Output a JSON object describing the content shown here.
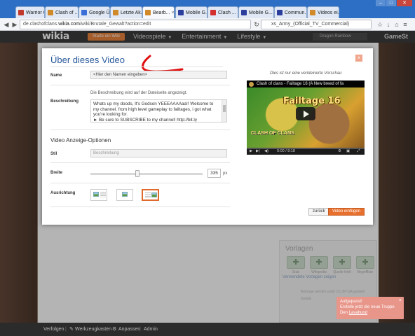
{
  "browser": {
    "tabs": [
      {
        "label": "Warrior C...",
        "color": "#c0392b"
      },
      {
        "label": "Clash of ...",
        "color": "#d08a2a"
      },
      {
        "label": "Google Ü...",
        "color": "#3b6fd8"
      },
      {
        "label": "Letzte Ak...",
        "color": "#d08a2a"
      },
      {
        "label": "Bearb...",
        "color": "#d08a2a"
      },
      {
        "label": "Mobile G...",
        "color": "#2c3e9c"
      },
      {
        "label": "Clash ...",
        "color": "#d32f2f"
      },
      {
        "label": "Mobile G...",
        "color": "#2c3e9c"
      },
      {
        "label": "Commun...",
        "color": "#2c3e9c"
      },
      {
        "label": "Videos ei...",
        "color": "#d08a2a"
      }
    ],
    "active_tab_index": 4,
    "url_prefix": "de.clashofclans.",
    "url_domain": "wikia.com",
    "url_rest": "/wiki/Brutale_Gewalt?action=edit",
    "search_value": "xs_Army_(Official_TV_Commercial)",
    "window_controls": {
      "min": "–",
      "max": "□",
      "close": "✕"
    }
  },
  "wikia_bar": {
    "logo": "wikia",
    "start_wiki_button": "Starte ein Wiki",
    "nav": [
      "Videospiele",
      "Entertainment",
      "Lifestyle"
    ],
    "user": "Dragon Rainbow",
    "partner": "GameSt"
  },
  "modal": {
    "title": "Über dieses Video",
    "close": "×",
    "name_label": "Name",
    "name_value": "<Hier den Namen eingeben>",
    "description_hint": "Die Beschreibung wird auf der Dateiseite angezeigt.",
    "description_label": "Beschreibung",
    "description_value": "Whats up my doods, It's Godson YEEEAAAAaa!! Welcome to my channel. from high level gameplay to failtages, i got what you're looking for.\n► Be sure to SUBSCRIBE to my channel! http://bit.ly",
    "section_title": "Video Anzeige-Optionen",
    "style_label": "Stil",
    "style_value": "Beschreibung",
    "width_label": "Breite",
    "width_value": "335",
    "width_unit": "px",
    "width_slider_fraction": 0.82,
    "align_label": "Ausrichtung",
    "align_options": [
      "left",
      "center",
      "right"
    ],
    "align_selected": "right",
    "preview_caption": "Dies ist nur eine verkleinerte Vorschau",
    "video_title": "Clash of clans - Failtage 16 (A New breed of fa",
    "thumb_banner": "Failtage 16",
    "thumb_logo": "CLASH OF CLANS",
    "video_time": "0:00 / 8:18",
    "back_button": "zurück",
    "insert_button": "Video einfügen",
    "accent_color": "#e8702e"
  },
  "rail": {
    "title": "Vorlagen",
    "templates": [
      "Stub",
      "Wikipedia",
      "Quelle fehlt",
      "Begriffklär"
    ],
    "link": "Verwendete Vorlagen zeigen",
    "note": "Beitrage werden unter CC-BY-SA gestellt",
    "more": "Details"
  },
  "toast": {
    "line1": "Aufgepasst!",
    "line2": "Erstelle jetzt die neue Truppe",
    "line3_prefix": "Den ",
    "line3_link": "Lavahund"
  },
  "bottom_bar": {
    "items": [
      "Verfolgen",
      "Werkzeugkasten",
      "Anpassen",
      "Admin"
    ]
  }
}
